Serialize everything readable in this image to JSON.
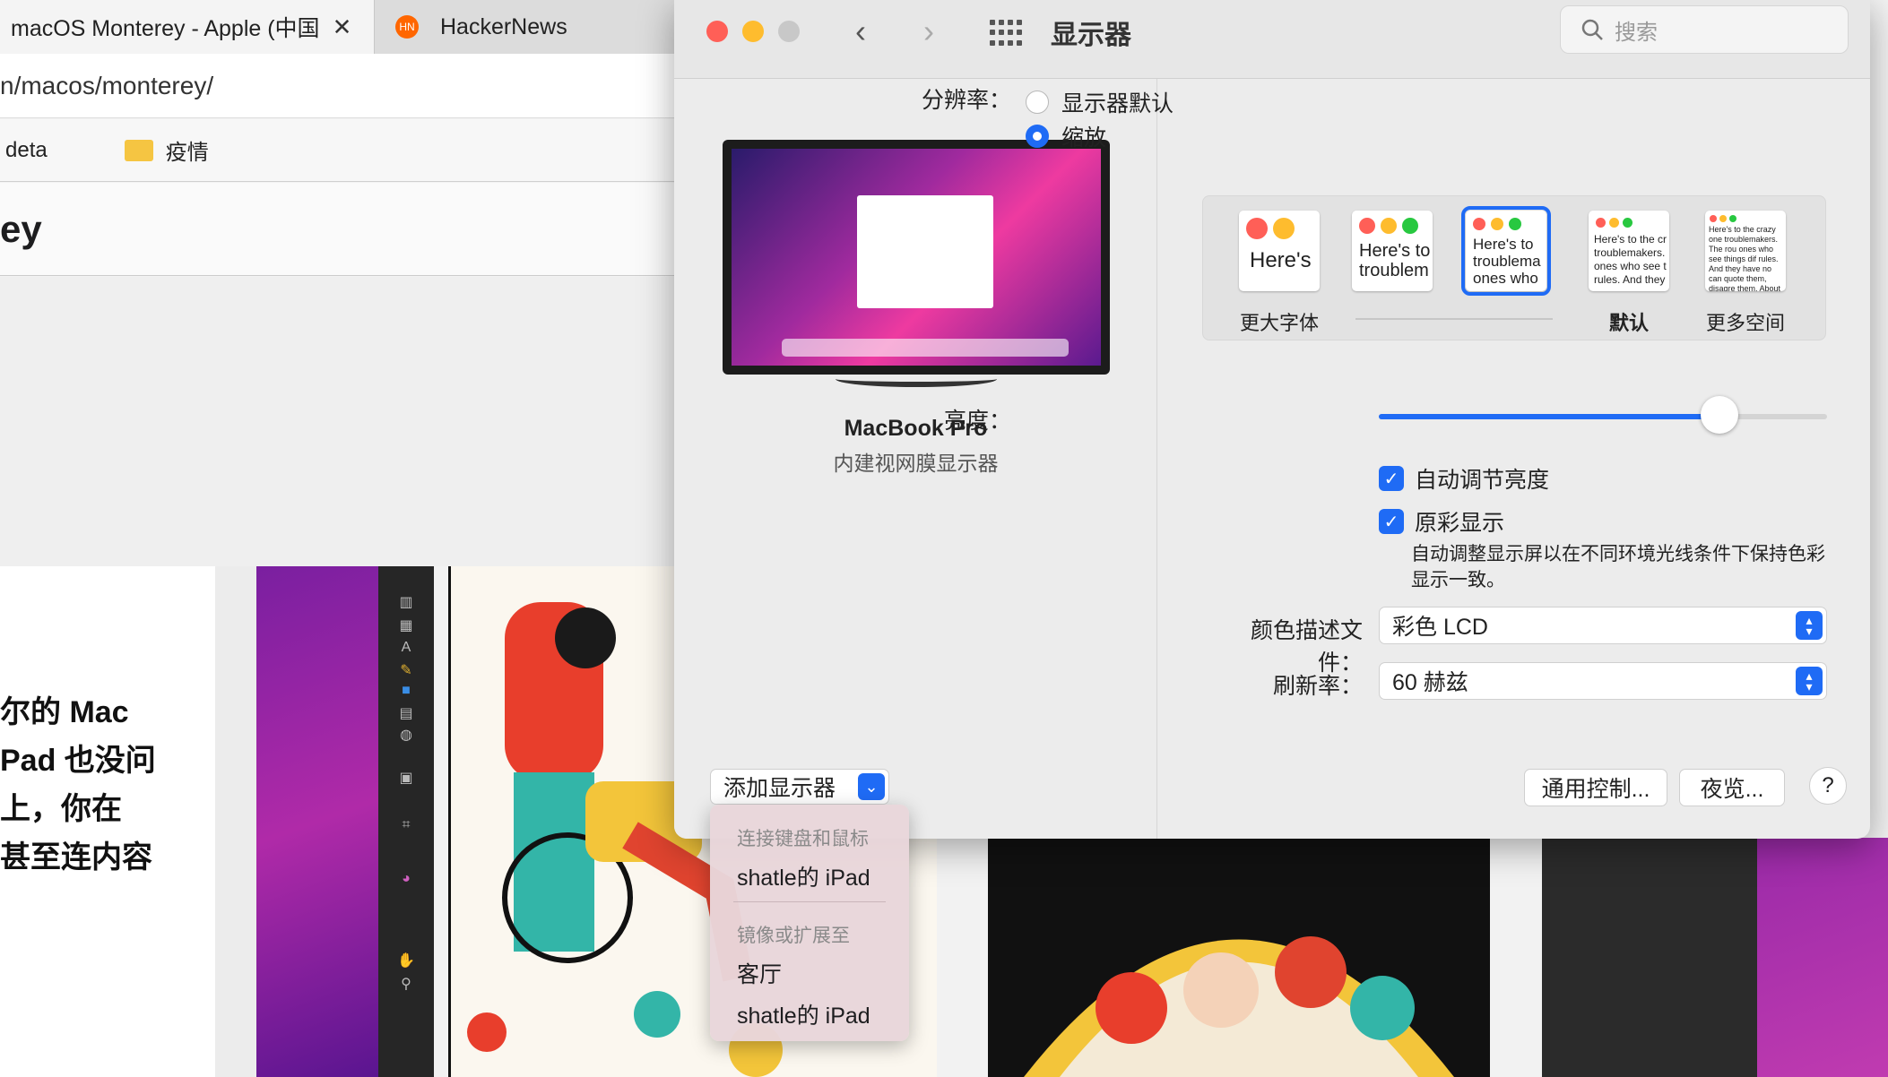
{
  "browser": {
    "tabs": [
      {
        "label": "macOS Monterey - Apple (中国",
        "close": "✕"
      },
      {
        "label": "HackerNews",
        "icon": "HN"
      }
    ],
    "url": "n/macos/monterey/",
    "bookmarks": [
      "deta",
      "疫情"
    ],
    "page_heading": "ey",
    "body_lines": [
      "尔的 Mac",
      "Pad 也没问",
      "上，你在",
      "甚至连内容"
    ]
  },
  "prefs": {
    "title": "显示器",
    "search_placeholder": "搜索",
    "display": {
      "name": "MacBook Pro",
      "subtitle": "内建视网膜显示器"
    },
    "resolution": {
      "label": "分辨率：",
      "options": [
        "显示器默认",
        "缩放"
      ],
      "selected": "缩放"
    },
    "scale_thumbs": [
      {
        "text": "Here's",
        "caption": "更大字体"
      },
      {
        "text": "Here's to troublem",
        "caption": ""
      },
      {
        "text": "Here's to troublema ones who",
        "caption": ""
      },
      {
        "text": "Here's to the cr troublemakers. ones who see t rules. And they",
        "caption": "默认"
      },
      {
        "text": "Here's to the crazy one troublemakers. The rou ones who see things dif rules. And they have no can quote them, disagre them. About the only th Because they change t",
        "caption": "更多空间"
      }
    ],
    "selected_thumb": 2,
    "brightness": {
      "label": "亮度：",
      "value": 0.76
    },
    "auto_brightness": {
      "label": "自动调节亮度",
      "checked": true
    },
    "true_tone": {
      "label": "原彩显示",
      "checked": true,
      "description": "自动调整显示屏以在不同环境光线条件下保持色彩显示一致。"
    },
    "color_profile": {
      "label": "颜色描述文件：",
      "value": "彩色 LCD"
    },
    "refresh_rate": {
      "label": "刷新率：",
      "value": "60 赫兹"
    },
    "add_display_label": "添加显示器",
    "buttons": {
      "universal_control": "通用控制...",
      "night_shift": "夜览...",
      "help": "?"
    }
  },
  "menu": {
    "section1_header": "连接键盘和鼠标",
    "section1_items": [
      "shatle的 iPad"
    ],
    "section2_header": "镜像或扩展至",
    "section2_items": [
      "客厅",
      "shatle的 iPad"
    ]
  },
  "colors": {
    "accent": "#1f6bf5",
    "close": "#ff5f57",
    "minimize": "#febc2e",
    "zoom": "#c8c8c8"
  }
}
